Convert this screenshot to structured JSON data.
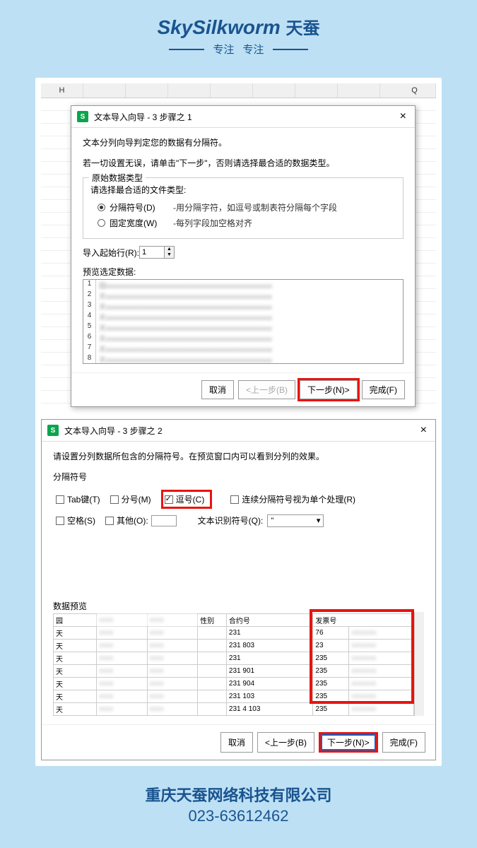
{
  "header": {
    "brand_en": "SkySilkworm",
    "brand_cn": "天蚕",
    "tagline1": "专注",
    "tagline2": "专注"
  },
  "spreadsheet": {
    "cols": [
      "H",
      "",
      "",
      "",
      "",
      "",
      "",
      "",
      "",
      "Q"
    ]
  },
  "dialog1": {
    "title": "文本导入向导 - 3 步骤之 1",
    "intro1": "文本分列向导判定您的数据有分隔符。",
    "intro2": "若一切设置无误，请单击\"下一步\"，否则请选择最合适的数据类型。",
    "group_title": "原始数据类型",
    "subtitle": "请选择最合适的文件类型:",
    "radio_delim": "分隔符号(D)",
    "radio_delim_desc": "-用分隔字符，如逗号或制表符分隔每个字段",
    "radio_fixed": "固定宽度(W)",
    "radio_fixed_desc": "-每列字段加空格对齐",
    "start_row_label": "导入起始行(R):",
    "start_row_value": "1",
    "preview_label": "预览选定数据:",
    "preview_rows": [
      1,
      2,
      3,
      4,
      5,
      6,
      7,
      8
    ],
    "cancel": "取消",
    "back": "<上一步(B)",
    "next": "下一步(N)>",
    "finish": "完成(F)"
  },
  "dialog2": {
    "title": "文本导入向导 - 3 步骤之 2",
    "intro": "请设置分列数据所包含的分隔符号。在预览窗口内可以看到分列的效果。",
    "sep_label": "分隔符号",
    "tab": "Tab键(T)",
    "semicolon": "分号(M)",
    "comma": "逗号(C)",
    "consecutive": "连续分隔符号视为单个处理(R)",
    "space": "空格(S)",
    "other": "其他(O):",
    "qualifier_label": "文本识别符号(Q):",
    "qualifier_value": "\"",
    "preview_label": "数据预览",
    "headers": [
      "园",
      "",
      "",
      "性别",
      "合约号",
      "发票号",
      ""
    ],
    "rows": [
      [
        "园",
        "",
        "",
        "",
        "",
        "",
        ""
      ],
      [
        "天",
        "",
        "",
        "",
        "231",
        "76",
        ""
      ],
      [
        "天",
        "",
        "",
        "",
        "231                   803",
        "23",
        ""
      ],
      [
        "天",
        "",
        "",
        "",
        "231",
        "235",
        ""
      ],
      [
        "天",
        "",
        "",
        "",
        "231                   901",
        "235",
        ""
      ],
      [
        "天",
        "",
        "",
        "",
        "231                   904",
        "235",
        ""
      ],
      [
        "天",
        "",
        "",
        "",
        "231                   103",
        "235",
        ""
      ],
      [
        "天",
        "",
        "",
        "",
        "231               4 103",
        "235",
        ""
      ]
    ],
    "cancel": "取消",
    "back": "<上一步(B)",
    "next": "下一步(N)>",
    "finish": "完成(F)"
  },
  "footer": {
    "company": "重庆天蚕网络科技有限公司",
    "phone": "023-63612462"
  }
}
